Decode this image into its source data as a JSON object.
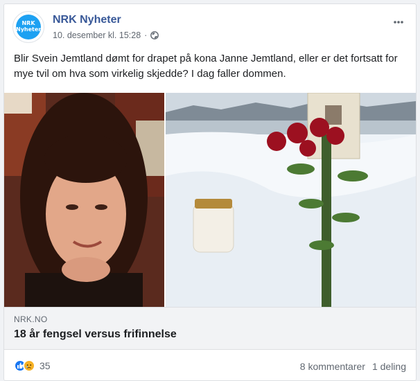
{
  "post": {
    "page_name": "NRK Nyheter",
    "avatar_text_line1": "NRK",
    "avatar_text_line2": "Nyheter",
    "timestamp": "10. desember kl. 15:28",
    "separator": "·",
    "privacy_icon": "globe-icon",
    "menu_icon": "more-options-icon",
    "text": "Blir Svein Jemtland dømt for drapet på kona Janne Jemtland, eller er det fortsatt for mye tvil om hva som virkelig skjedde? I dag faller dommen."
  },
  "link": {
    "domain": "NRK.NO",
    "headline": "18 år fengsel versus frifinnelse"
  },
  "footer": {
    "reaction_icons": [
      "like-icon",
      "sad-icon"
    ],
    "reaction_count": "35",
    "comments": "8 kommentarer",
    "shares": "1 deling"
  },
  "colors": {
    "page_name": "#385898",
    "avatar_bg": "#1da1f2",
    "like_blue": "#1877f2",
    "sad_yellow": "#f7b125"
  }
}
